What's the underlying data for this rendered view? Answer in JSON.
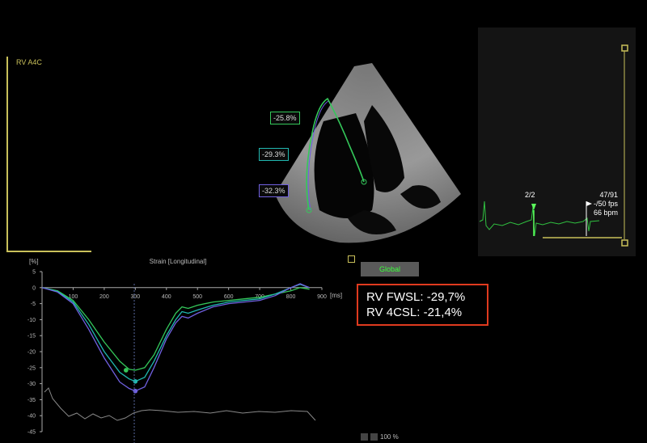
{
  "view_label": "RV A4C",
  "segments": [
    "-25.8%",
    "-29.3%",
    "-32.3%"
  ],
  "global_button": "Global",
  "results": {
    "line1": "RV FWSL: -29,7%",
    "line2": "RV 4CSL: -21,4%"
  },
  "ecg": {
    "marker": "2/2",
    "frame": "47/91",
    "fps": "-/50 fps",
    "bpm": "66 bpm"
  },
  "zoom": "100 %",
  "colors": {
    "accent": "#c9c05a",
    "highlight": "#e03a1f",
    "curve_green": "#34c75a",
    "curve_teal": "#20b8b0",
    "curve_purple": "#7060e0"
  },
  "chart_data": {
    "type": "line",
    "title": "Strain [Longitudinal]",
    "ylabel": "[%]",
    "xlabel": "[ms]",
    "xlim": [
      0,
      900
    ],
    "ylim": [
      -45,
      5
    ],
    "x_ticks": [
      "100",
      "200",
      "300",
      "400",
      "500",
      "600",
      "700",
      "800",
      "900"
    ],
    "y_ticks": [
      "5",
      "0",
      "-5",
      "-10",
      "-15",
      "-20",
      "-25",
      "-30",
      "-35",
      "-40",
      "-45"
    ],
    "x": [
      0,
      50,
      100,
      150,
      200,
      250,
      280,
      300,
      330,
      360,
      400,
      430,
      450,
      470,
      500,
      550,
      600,
      650,
      700,
      750,
      800,
      830,
      860
    ],
    "series": [
      {
        "values": [
          0,
          -1,
          -4,
          -10,
          -17,
          -23,
          -25.5,
          -25.8,
          -25,
          -21,
          -13,
          -8,
          -6,
          -6.5,
          -5.5,
          -4.5,
          -4,
          -3.5,
          -3,
          -2,
          -1,
          0,
          -0.5
        ]
      },
      {
        "values": [
          0,
          -1.2,
          -4.5,
          -11.5,
          -20,
          -26.5,
          -28.5,
          -29.3,
          -28,
          -23,
          -15,
          -10,
          -7.5,
          -8,
          -7,
          -5.5,
          -4.5,
          -4,
          -3.5,
          -2,
          0,
          1,
          0
        ]
      },
      {
        "values": [
          0,
          -1.4,
          -5,
          -13,
          -22,
          -29.5,
          -31.5,
          -32.3,
          -31,
          -25,
          -16,
          -11,
          -9,
          -9.5,
          -8,
          -6,
          -5,
          -4.5,
          -4,
          -2.5,
          0,
          1.2,
          0
        ]
      }
    ],
    "markers": [
      {
        "x": 270,
        "y": -25.8
      },
      {
        "x": 300,
        "y": -29.3
      },
      {
        "x": 300,
        "y": -32.3
      }
    ]
  }
}
